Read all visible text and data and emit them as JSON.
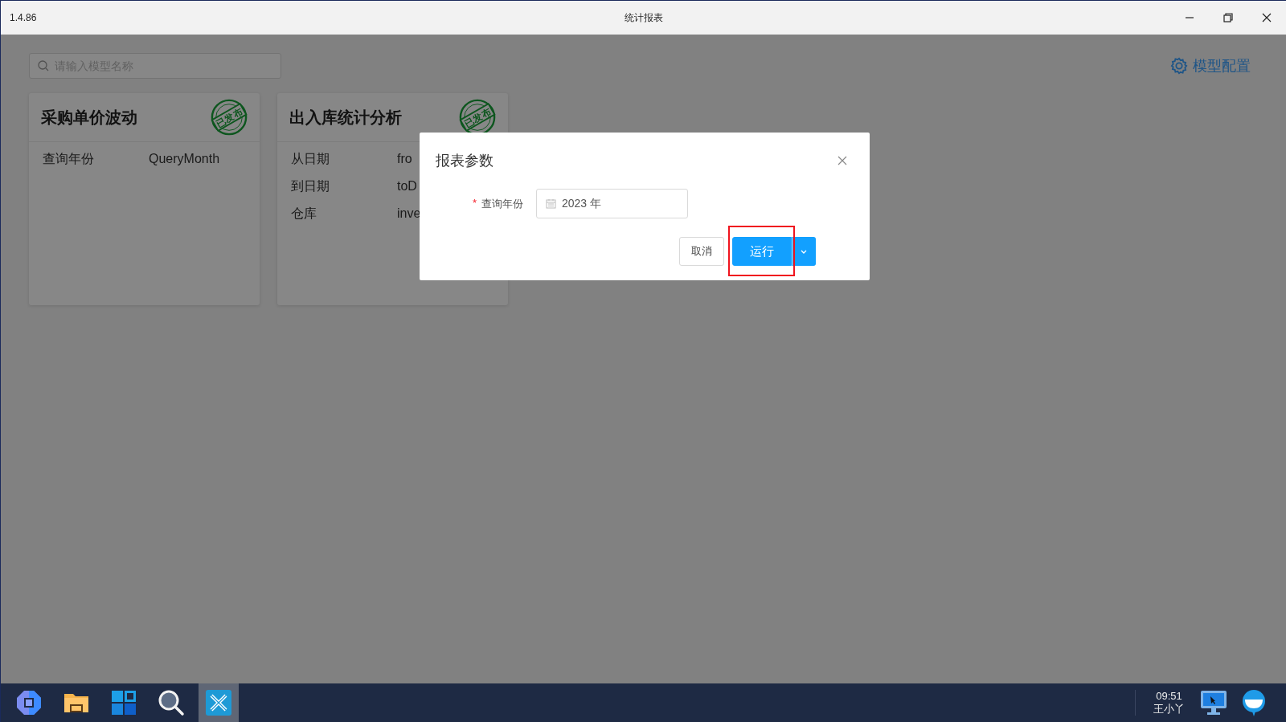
{
  "window": {
    "version": "1.4.86",
    "title": "统计报表"
  },
  "search": {
    "placeholder": "请输入模型名称"
  },
  "config_link": "模型配置",
  "cards": [
    {
      "title": "采购单价波动",
      "stamp": "已发布",
      "params": [
        {
          "label": "查询年份",
          "value": "QueryMonth"
        }
      ]
    },
    {
      "title": "出入库统计分析",
      "stamp": "已发布",
      "params": [
        {
          "label": "从日期",
          "value": "fro"
        },
        {
          "label": "到日期",
          "value": "toD"
        },
        {
          "label": "仓库",
          "value": "inve"
        }
      ]
    }
  ],
  "dialog": {
    "title": "报表参数",
    "fields": [
      {
        "label": "查询年份",
        "required_mark": "*",
        "value": "2023 年"
      }
    ],
    "buttons": [
      {
        "label": "取消",
        "kind": "default",
        "highlighted": false
      },
      {
        "label": "运行",
        "kind": "primary",
        "highlighted": true
      }
    ]
  },
  "taskbar": {
    "apps": [
      {
        "kind": "hub",
        "selected": false
      },
      {
        "kind": "folder",
        "selected": false
      },
      {
        "kind": "start",
        "selected": false
      },
      {
        "kind": "search",
        "selected": false
      },
      {
        "kind": "notes",
        "selected": true
      }
    ],
    "clock": "09:51",
    "user": "王小丫"
  }
}
